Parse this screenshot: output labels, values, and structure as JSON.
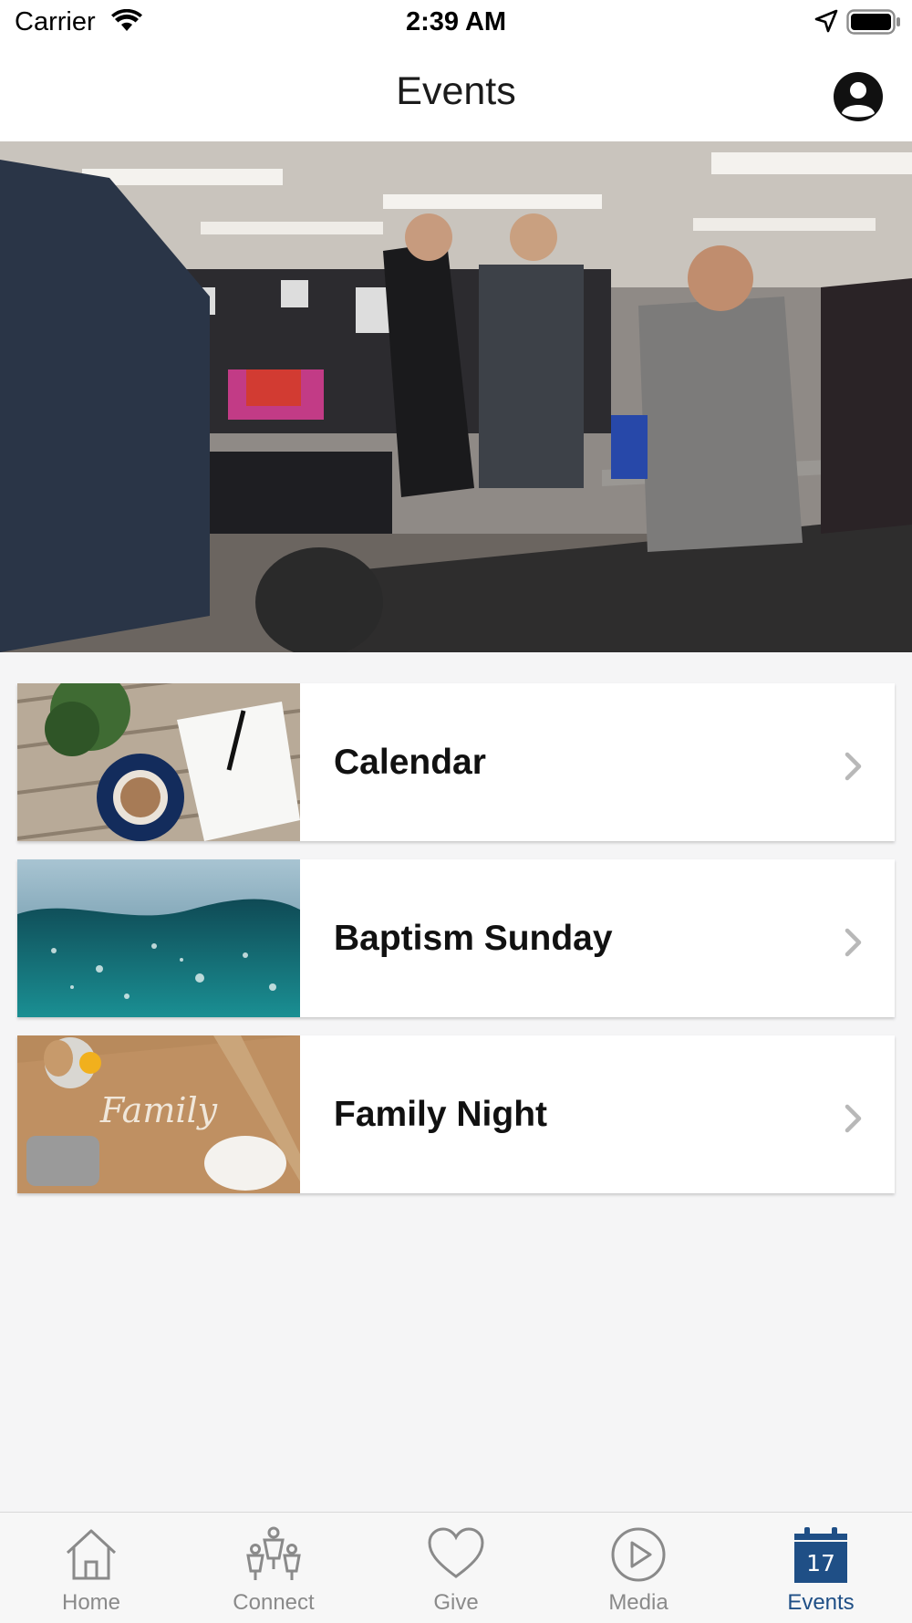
{
  "status_bar": {
    "carrier": "Carrier",
    "time": "2:39 AM"
  },
  "header": {
    "title": "Events"
  },
  "events": [
    {
      "label": "Calendar"
    },
    {
      "label": "Baptism Sunday"
    },
    {
      "label": "Family Night"
    }
  ],
  "thumb_text": {
    "family": "Family"
  },
  "tabs": [
    {
      "label": "Home",
      "icon": "home-icon"
    },
    {
      "label": "Connect",
      "icon": "connect-icon"
    },
    {
      "label": "Give",
      "icon": "heart-icon"
    },
    {
      "label": "Media",
      "icon": "play-icon"
    },
    {
      "label": "Events",
      "icon": "calendar-icon",
      "badge": "17",
      "active": true
    }
  ],
  "colors": {
    "accent": "#1f4f86",
    "inactive": "#8a8a8a",
    "background": "#f5f5f6"
  }
}
